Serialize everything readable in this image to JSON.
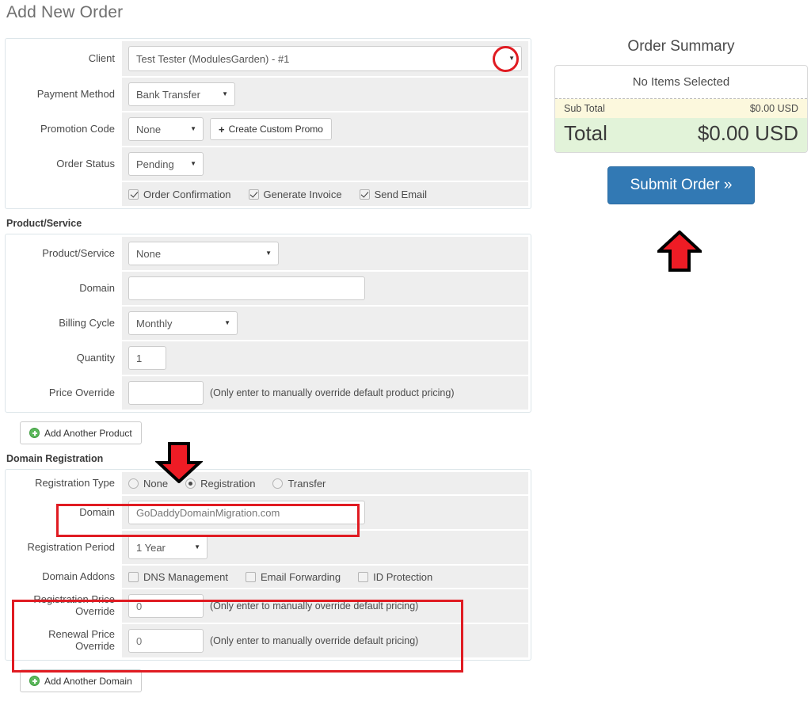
{
  "page": {
    "title": "Add New Order"
  },
  "order_form": {
    "rows": {
      "client": {
        "label": "Client",
        "value": "Test Tester (ModulesGarden) - #1"
      },
      "payment_method": {
        "label": "Payment Method",
        "value": "Bank Transfer"
      },
      "promotion_code": {
        "label": "Promotion Code",
        "value": "None",
        "button": "Create Custom Promo"
      },
      "order_status": {
        "label": "Order Status",
        "value": "Pending"
      }
    },
    "options": [
      {
        "label": "Order Confirmation",
        "checked": true
      },
      {
        "label": "Generate Invoice",
        "checked": true
      },
      {
        "label": "Send Email",
        "checked": true
      }
    ]
  },
  "product_section": {
    "heading": "Product/Service",
    "rows": {
      "product": {
        "label": "Product/Service",
        "value": "None"
      },
      "domain": {
        "label": "Domain",
        "value": ""
      },
      "billing_cycle": {
        "label": "Billing Cycle",
        "value": "Monthly"
      },
      "quantity": {
        "label": "Quantity",
        "value": "1"
      },
      "price_override": {
        "label": "Price Override",
        "value": "",
        "hint": "(Only enter to manually override default product pricing)"
      }
    },
    "add_button": "Add Another Product"
  },
  "domain_section": {
    "heading": "Domain Registration",
    "registration_type": {
      "label": "Registration Type",
      "options": [
        {
          "label": "None",
          "selected": false
        },
        {
          "label": "Registration",
          "selected": true
        },
        {
          "label": "Transfer",
          "selected": false
        }
      ]
    },
    "domain": {
      "label": "Domain",
      "value": "GoDaddyDomainMigration.com"
    },
    "registration_period": {
      "label": "Registration Period",
      "value": "1 Year"
    },
    "addons": {
      "label": "Domain Addons",
      "options": [
        {
          "label": "DNS Management",
          "checked": false
        },
        {
          "label": "Email Forwarding",
          "checked": false
        },
        {
          "label": "ID Protection",
          "checked": false
        }
      ]
    },
    "registration_price_override": {
      "label": "Registration Price Override",
      "value": "0",
      "hint": "(Only enter to manually override default pricing)"
    },
    "renewal_price_override": {
      "label": "Renewal Price Override",
      "value": "0",
      "hint": "(Only enter to manually override default pricing)"
    },
    "add_button": "Add Another Domain"
  },
  "summary": {
    "title": "Order Summary",
    "empty_text": "No Items Selected",
    "sub_total_label": "Sub Total",
    "sub_total_value": "$0.00 USD",
    "total_label": "Total",
    "total_value": "$0.00 USD",
    "submit_label": "Submit Order »"
  },
  "colors": {
    "accent_blue": "#3279b4",
    "annotation_red": "#e01b22",
    "subtotal_bg": "#fcf8dd",
    "total_bg": "#e2f3d9",
    "field_bg": "#eeeeee",
    "table_border": "#dce5e9"
  }
}
